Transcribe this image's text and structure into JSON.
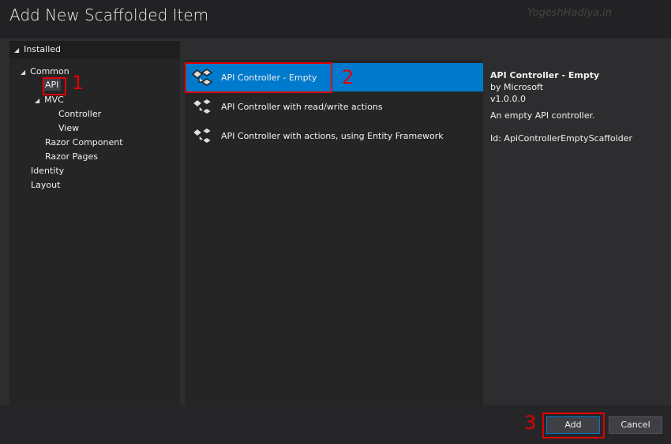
{
  "window": {
    "title": "Add New Scaffolded Item",
    "watermark": "YogeshHadiya.in"
  },
  "tree": {
    "header": "Installed",
    "items": [
      {
        "label": "Common",
        "expanded": true
      },
      {
        "label": "API",
        "selected": true
      },
      {
        "label": "MVC",
        "expanded": true
      },
      {
        "label": "Controller"
      },
      {
        "label": "View"
      },
      {
        "label": "Razor Component"
      },
      {
        "label": "Razor Pages"
      },
      {
        "label": "Identity"
      },
      {
        "label": "Layout"
      }
    ]
  },
  "templates": [
    {
      "label": "API Controller - Empty",
      "selected": true,
      "icon": "api-controller-icon"
    },
    {
      "label": "API Controller with read/write actions",
      "icon": "api-controller-icon"
    },
    {
      "label": "API Controller with actions, using Entity Framework",
      "icon": "api-controller-icon"
    }
  ],
  "details": {
    "name": "API Controller - Empty",
    "author": "by Microsoft",
    "version": "v1.0.0.0",
    "description": "An empty API controller.",
    "id": "Id: ApiControllerEmptyScaffolder"
  },
  "annotations": {
    "one": "1",
    "two": "2",
    "three": "3"
  },
  "buttons": {
    "add": "Add",
    "cancel": "Cancel"
  },
  "colors": {
    "accent": "#007acc",
    "annotation": "#e00000"
  }
}
